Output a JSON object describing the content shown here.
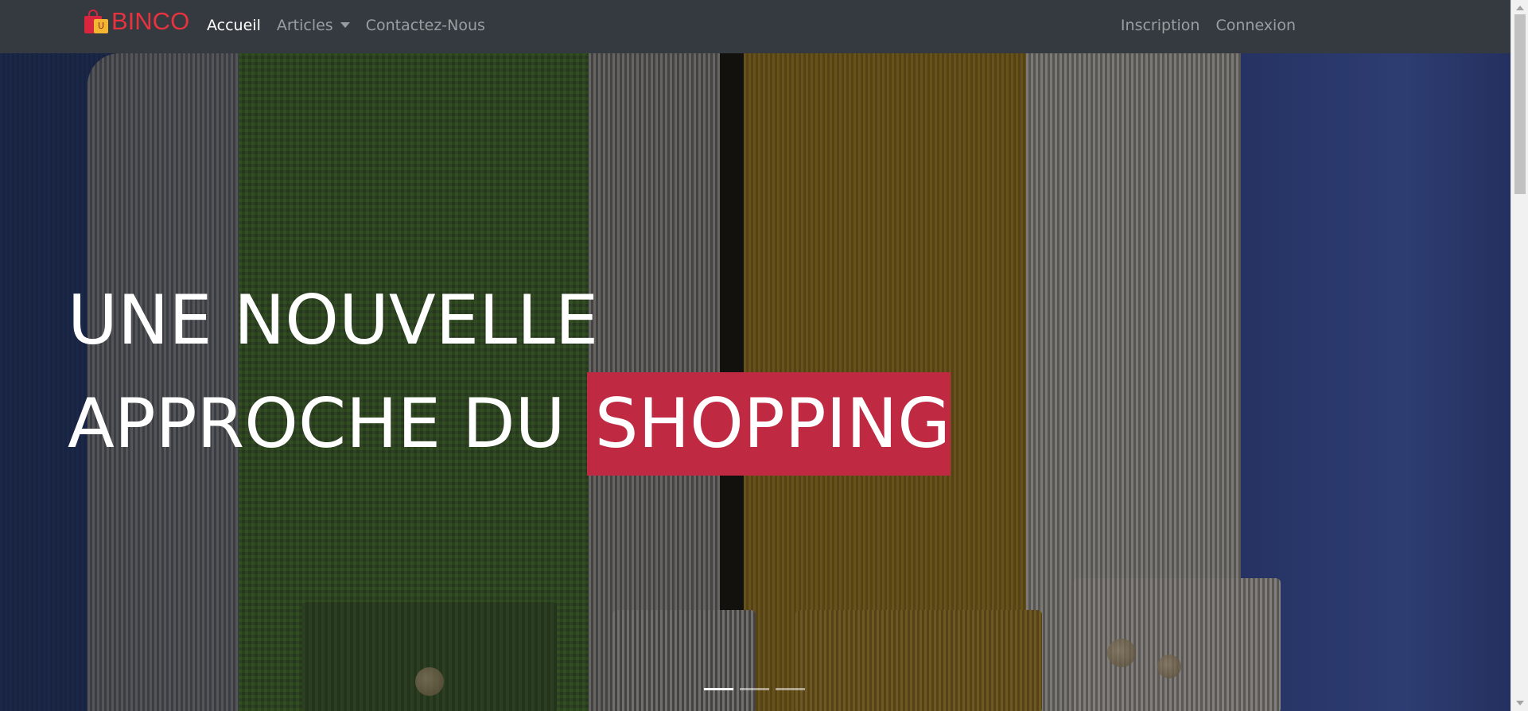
{
  "navbar": {
    "brand": {
      "bag_letter": "U",
      "text": "BINCO"
    },
    "left_links": [
      {
        "label": "Accueil",
        "active": true
      },
      {
        "label": "Articles",
        "dropdown": true
      },
      {
        "label": "Contactez-Nous"
      }
    ],
    "right_links": [
      {
        "label": "Inscription"
      },
      {
        "label": "Connexion"
      }
    ]
  },
  "hero": {
    "line1": "UNE NOUVELLE",
    "line2_prefix": "APPROCHE DU ",
    "line2_highlight": "SHOPPING",
    "highlight_color": "#bf2a42",
    "indicators": [
      {
        "active": true
      },
      {
        "active": false
      },
      {
        "active": false
      }
    ]
  },
  "colors": {
    "navbar_bg": "#343a40",
    "brand_red": "#e8333f"
  }
}
